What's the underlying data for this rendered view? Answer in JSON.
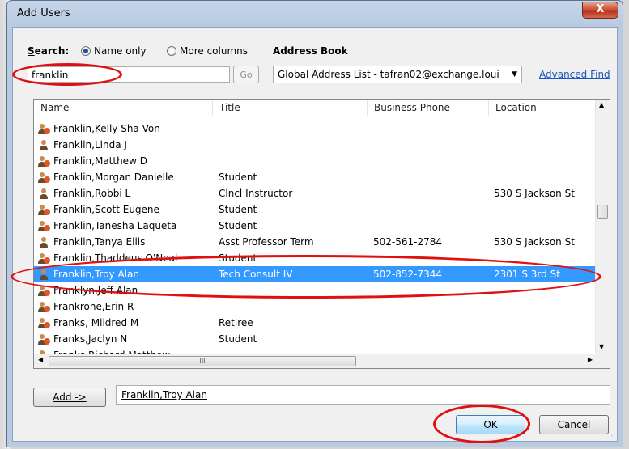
{
  "window": {
    "title": "Add Users",
    "close_label": "X"
  },
  "search": {
    "label_prefix": "S",
    "label_rest": "earch:",
    "option_name_only": "Name only",
    "option_more_columns": "More columns",
    "value": "franklin",
    "go_label": "Go"
  },
  "address_book": {
    "label": "Address Book",
    "selected": "Global Address List - tafran02@exchange.loui",
    "advanced_find": "Advanced Find"
  },
  "columns": [
    "Name",
    "Title",
    "Business Phone",
    "Location"
  ],
  "rows": [
    {
      "icon": "group",
      "name": "Franklin,Kelly Sha Von",
      "title": "",
      "phone": "",
      "location": ""
    },
    {
      "icon": "user",
      "name": "Franklin,Linda J",
      "title": "",
      "phone": "",
      "location": ""
    },
    {
      "icon": "group",
      "name": "Franklin,Matthew D",
      "title": "",
      "phone": "",
      "location": ""
    },
    {
      "icon": "group",
      "name": "Franklin,Morgan Danielle",
      "title": "Student",
      "phone": "",
      "location": ""
    },
    {
      "icon": "user",
      "name": "Franklin,Robbi L",
      "title": "Clncl Instructor",
      "phone": "",
      "location": "530 S Jackson St"
    },
    {
      "icon": "group",
      "name": "Franklin,Scott Eugene",
      "title": "Student",
      "phone": "",
      "location": ""
    },
    {
      "icon": "group",
      "name": "Franklin,Tanesha Laqueta",
      "title": "Student",
      "phone": "",
      "location": ""
    },
    {
      "icon": "user",
      "name": "Franklin,Tanya Ellis",
      "title": "Asst Professor Term",
      "phone": "502-561-2784",
      "location": "530 S Jackson St"
    },
    {
      "icon": "group",
      "name": "Franklin,Thaddeus O'Neal",
      "title": "Student",
      "phone": "",
      "location": ""
    },
    {
      "icon": "user",
      "name": "Franklin,Troy Alan",
      "title": "Tech Consult IV",
      "phone": "502-852-7344",
      "location": "2301 S 3rd St",
      "selected": true
    },
    {
      "icon": "group",
      "name": "Franklyn,Jeff Alan",
      "title": "",
      "phone": "",
      "location": ""
    },
    {
      "icon": "group",
      "name": "Frankrone,Erin R",
      "title": "",
      "phone": "",
      "location": ""
    },
    {
      "icon": "group",
      "name": "Franks, Mildred M",
      "title": "Retiree",
      "phone": "",
      "location": ""
    },
    {
      "icon": "group",
      "name": "Franks,Jaclyn N",
      "title": "Student",
      "phone": "",
      "location": ""
    },
    {
      "icon": "group",
      "name": "Franks,Richard Matthew",
      "title": "",
      "phone": "",
      "location": ""
    }
  ],
  "add": {
    "button_label": "Add ->",
    "added_value": "Franklin,Troy Alan"
  },
  "buttons": {
    "ok": "OK",
    "cancel": "Cancel"
  },
  "colors": {
    "selection": "#3399ff",
    "annotation": "#e01010",
    "link": "#1a55b8"
  }
}
